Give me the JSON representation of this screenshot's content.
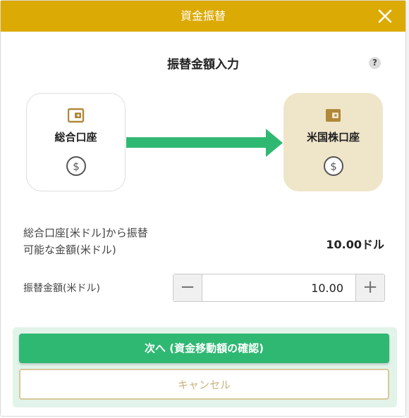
{
  "header": {
    "title": "資金振替",
    "close_icon": "close-icon"
  },
  "content": {
    "title": "振替金額入力",
    "help_icon": "?",
    "from_account": {
      "name": "総合口座",
      "wallet_icon": "wallet-icon",
      "currency_icon": "dollar-icon"
    },
    "to_account": {
      "name": "米国株口座",
      "wallet_icon": "wallet-icon",
      "currency_icon": "dollar-icon"
    },
    "available": {
      "label_line1": "総合口座[米ドル]から振替",
      "label_line2": "可能な金額(米ドル)",
      "amount": "10.00ドル"
    },
    "transfer_amount": {
      "label": "振替金額(米ドル)",
      "value": "10.00",
      "minus": "−",
      "plus": "+"
    }
  },
  "footer": {
    "next_label": "次へ (資金移動額の確認)",
    "cancel_label": "キャンセル"
  },
  "colors": {
    "header": "#dcaa05",
    "accent_green": "#2fb872",
    "target_account_bg": "#efe5c9",
    "wallet_gold": "#b0883a"
  }
}
